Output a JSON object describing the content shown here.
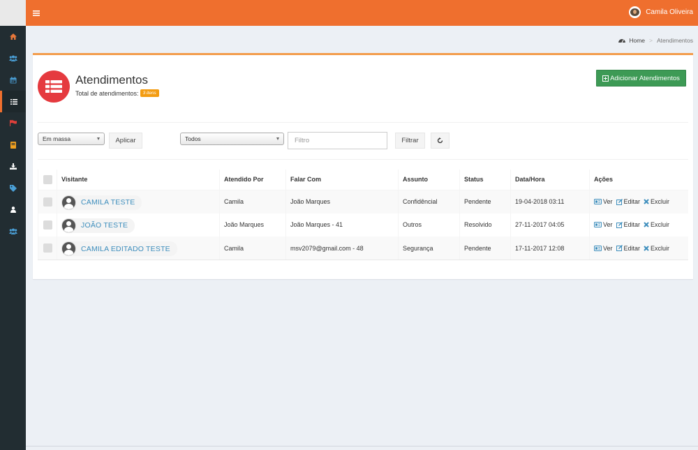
{
  "header": {
    "user_name": "Camila Oliveira"
  },
  "sidebar": {
    "items": [
      {
        "icon": "home-icon",
        "active": false
      },
      {
        "icon": "users-icon",
        "active": false
      },
      {
        "icon": "calendar-icon",
        "active": false
      },
      {
        "icon": "list-icon",
        "active": true
      },
      {
        "icon": "flag-icon",
        "active": false
      },
      {
        "icon": "book-icon",
        "active": false
      },
      {
        "icon": "download-icon",
        "active": false
      },
      {
        "icon": "tag-icon",
        "active": false
      },
      {
        "icon": "user-icon",
        "active": false
      },
      {
        "icon": "group-icon",
        "active": false
      }
    ]
  },
  "breadcrumb": {
    "home": "Home",
    "current": "Atendimentos"
  },
  "page": {
    "title": "Atendimentos",
    "subtitle": "Total de atendimentos:",
    "count_badge": "3 itens",
    "add_button": "Adicionar Atendimentos"
  },
  "filters": {
    "bulk_select": "Em massa",
    "apply_button": "Aplicar",
    "status_select": "Todos",
    "filter_placeholder": "Filtro",
    "filter_button": "Filtrar"
  },
  "table": {
    "headers": [
      "Visitante",
      "Atendido Por",
      "Falar Com",
      "Assunto",
      "Status",
      "Data/Hora",
      "Ações"
    ],
    "rows": [
      {
        "visitante": "CAMILA TESTE",
        "atendido_por": "Camila",
        "falar_com": "João Marques",
        "assunto": "Confidêncial",
        "status": "Pendente",
        "data_hora": "19-04-2018 03:11"
      },
      {
        "visitante": "JOÃO TESTE",
        "atendido_por": "João Marques",
        "falar_com": "João Marques - 41",
        "assunto": "Outros",
        "status": "Resolvido",
        "data_hora": "27-11-2017 04:05"
      },
      {
        "visitante": "CAMILA EDITADO TESTE",
        "atendido_por": "Camila",
        "falar_com": "msv2079@gmail.com - 48",
        "assunto": "Segurança",
        "status": "Pendente",
        "data_hora": "17-11-2017 12:08"
      }
    ],
    "actions": {
      "view": "Ver",
      "edit": "Editar",
      "delete": "Excluir"
    }
  },
  "colors": {
    "header": "#ef6f2e",
    "sidebar": "#222d32",
    "title_icon": "#e53a3f",
    "add_button": "#3d9a55",
    "badge": "#f39c12",
    "link": "#3c8dbc"
  }
}
